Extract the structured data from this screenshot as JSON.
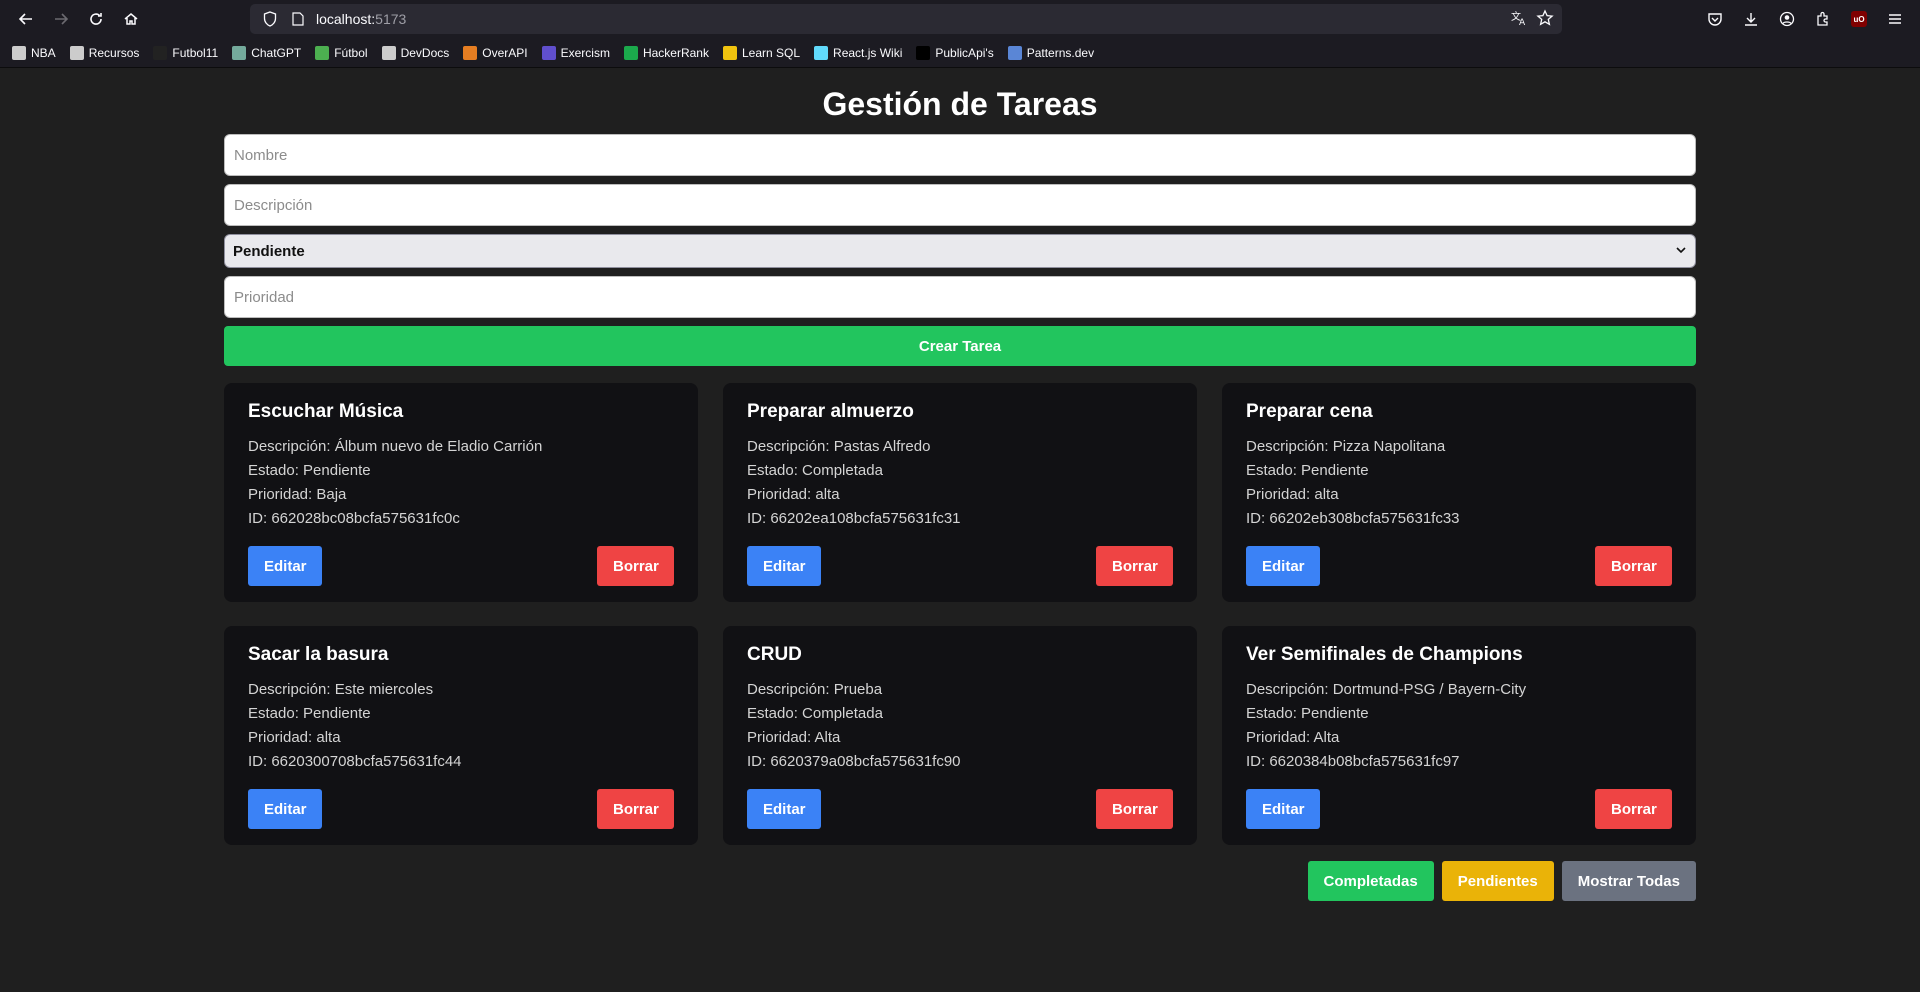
{
  "browser": {
    "url_host": "localhost:",
    "url_port": "5173",
    "bookmarks": [
      {
        "label": "NBA",
        "icon": "globe-icon",
        "color": "#cccccc"
      },
      {
        "label": "Recursos",
        "icon": "folder-icon",
        "color": "#cccccc"
      },
      {
        "label": "Futbol11",
        "icon": "futbol11-icon",
        "color": "#222222"
      },
      {
        "label": "ChatGPT",
        "icon": "chatgpt-icon",
        "color": "#74aa9c"
      },
      {
        "label": "Fútbol",
        "icon": "soccer-ball-icon",
        "color": "#4caf50"
      },
      {
        "label": "DevDocs",
        "icon": "devdocs-icon",
        "color": "#cccccc"
      },
      {
        "label": "OverAPI",
        "icon": "overapi-icon",
        "color": "#e67e22"
      },
      {
        "label": "Exercism",
        "icon": "exercism-icon",
        "color": "#604fcd"
      },
      {
        "label": "HackerRank",
        "icon": "hackerrank-icon",
        "color": "#1ba94c"
      },
      {
        "label": "Learn SQL",
        "icon": "key-icon",
        "color": "#f1c40f"
      },
      {
        "label": "React.js Wiki",
        "icon": "react-icon",
        "color": "#61dafb"
      },
      {
        "label": "PublicApi's",
        "icon": "publicapis-icon",
        "color": "#000000"
      },
      {
        "label": "Patterns.dev",
        "icon": "patterns-icon",
        "color": "#5a86d6"
      }
    ]
  },
  "app": {
    "title": "Gestión de Tareas",
    "form": {
      "name_placeholder": "Nombre",
      "description_placeholder": "Descripción",
      "status_selected": "Pendiente",
      "priority_placeholder": "Prioridad",
      "submit_label": "Crear Tarea"
    },
    "labels": {
      "description": "Descripción: ",
      "status": "Estado: ",
      "priority": "Prioridad: ",
      "id": "ID: ",
      "edit": "Editar",
      "delete": "Borrar"
    },
    "tasks": [
      {
        "title": "Escuchar Música",
        "description": "Álbum nuevo de Eladio Carrión",
        "status": "Pendiente",
        "priority": "Baja",
        "id": "662028bc08bcfa575631fc0c"
      },
      {
        "title": "Preparar almuerzo",
        "description": "Pastas Alfredo",
        "status": "Completada",
        "priority": "alta",
        "id": "66202ea108bcfa575631fc31"
      },
      {
        "title": "Preparar cena",
        "description": "Pizza Napolitana",
        "status": "Pendiente",
        "priority": "alta",
        "id": "66202eb308bcfa575631fc33"
      },
      {
        "title": "Sacar la basura",
        "description": "Este miercoles",
        "status": "Pendiente",
        "priority": "alta",
        "id": "6620300708bcfa575631fc44"
      },
      {
        "title": "CRUD",
        "description": "Prueba",
        "status": "Completada",
        "priority": "Alta",
        "id": "6620379a08bcfa575631fc90"
      },
      {
        "title": "Ver Semifinales de Champions",
        "description": "Dortmund-PSG / Bayern-City",
        "status": "Pendiente",
        "priority": "Alta",
        "id": "6620384b08bcfa575631fc97"
      }
    ],
    "filters": {
      "completed": "Completadas",
      "pending": "Pendientes",
      "all": "Mostrar Todas"
    }
  }
}
